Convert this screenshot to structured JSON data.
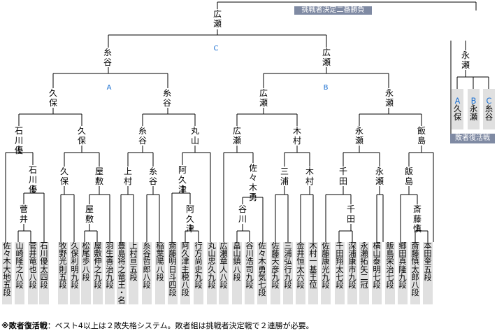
{
  "header": {
    "banner": "挑戦者決定二番勝負"
  },
  "finalists": {
    "top": "広瀬"
  },
  "group_labels": {
    "c": "C",
    "a": "A",
    "b": "B"
  },
  "rounds": {
    "r4": [
      "糸谷",
      "広瀬"
    ],
    "r3": [
      "久保",
      "糸谷",
      "広瀬",
      "永瀬"
    ],
    "r2": [
      "石川優",
      "久保",
      "糸谷",
      "丸山",
      "広瀬",
      "木村",
      "永瀬",
      "飯島"
    ],
    "r1": [
      "石川優",
      "菅井",
      "久保",
      "屋敷",
      "屋敷",
      "上村",
      "糸谷",
      "阿久津",
      "阿久津",
      "佐々木勇",
      "谷川",
      "三浦",
      "木村",
      "千田",
      "千田",
      "永瀬",
      "飯島",
      "斎藤慎"
    ]
  },
  "players": [
    "佐々木大地五段",
    "山崎隆之八段",
    "菅井竜也八段",
    "石川優太四段",
    "牧野光則五段",
    "久保利明九段",
    "松尾歩八段",
    "屋敷伸之九段",
    "羽生善治九段",
    "豊島将之竜王・名人",
    "上村亘五段",
    "糸谷哲郎八段",
    "稲葉陽八段",
    "斎藤明日斗四段",
    "阿久津主税八段",
    "行方尚史九段",
    "丸山忠久九段",
    "広瀬章人八段",
    "畠山鎮八段",
    "谷川浩司九段",
    "佐々木勇気七段",
    "佐藤天彦九段",
    "三浦弘行九段",
    "金井恒太六段",
    "木村一基王位",
    "佐藤康光九段",
    "千田翔太七段",
    "深浦康市九段",
    "永瀬拓矢二冠",
    "横山泰明七段",
    "飯島栄治七段",
    "郷田真隆九段",
    "斎藤慎太郎八段",
    "本田奎五段"
  ],
  "repechage": {
    "winner": "永瀬",
    "banner": "敗者復活戦",
    "boxes": [
      {
        "letter": "A",
        "name": "久保"
      },
      {
        "letter": "B",
        "name": "永瀬"
      },
      {
        "letter": "C",
        "name": "糸谷"
      }
    ]
  },
  "footnote": {
    "bold": "※敗者復活戦",
    "text": "：ベスト4以上は２敗失格システム。敗者組は挑戦者決定戦で２連勝が必要。"
  },
  "colors": {
    "line": "#000000",
    "cell_bg": "#e0e0e0",
    "banner_bg": "#7f8aa3",
    "group_label": "#1a6fd1"
  }
}
